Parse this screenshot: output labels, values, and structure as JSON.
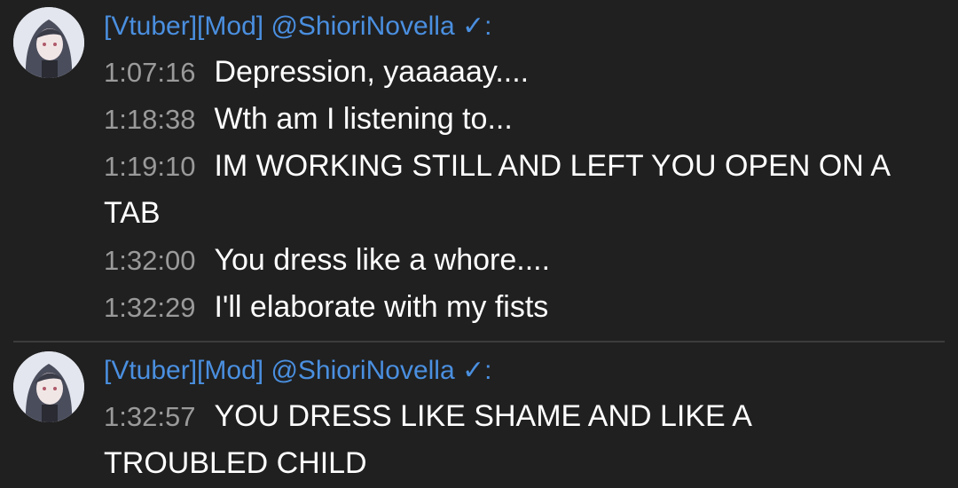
{
  "groups": [
    {
      "author": {
        "badges": "[Vtuber][Mod]",
        "name": "@ShioriNovella",
        "verified_glyph": "✓",
        "suffix": ":",
        "avatar_icon": "avatar-icon"
      },
      "messages": [
        {
          "time": "1:07:16",
          "text": "Depression, yaaaaay...."
        },
        {
          "time": "1:18:38",
          "text": "Wth am I listening to..."
        },
        {
          "time": "1:19:10",
          "text": "IM WORKING STILL AND LEFT YOU OPEN ON A TAB"
        },
        {
          "time": "1:32:00",
          "text": "You dress like a whore...."
        },
        {
          "time": "1:32:29",
          "text": "I'll elaborate with my fists"
        }
      ]
    },
    {
      "author": {
        "badges": "[Vtuber][Mod]",
        "name": "@ShioriNovella",
        "verified_glyph": "✓",
        "suffix": ":",
        "avatar_icon": "avatar-icon"
      },
      "messages": [
        {
          "time": "1:32:57",
          "text": "YOU DRESS LIKE SHAME AND LIKE A TROUBLED CHILD"
        }
      ]
    }
  ],
  "colors": {
    "background": "#202020",
    "author": "#4a8fe0",
    "timestamp": "#9a9a9a",
    "message": "#ffffff",
    "divider": "#3c3c3c"
  }
}
